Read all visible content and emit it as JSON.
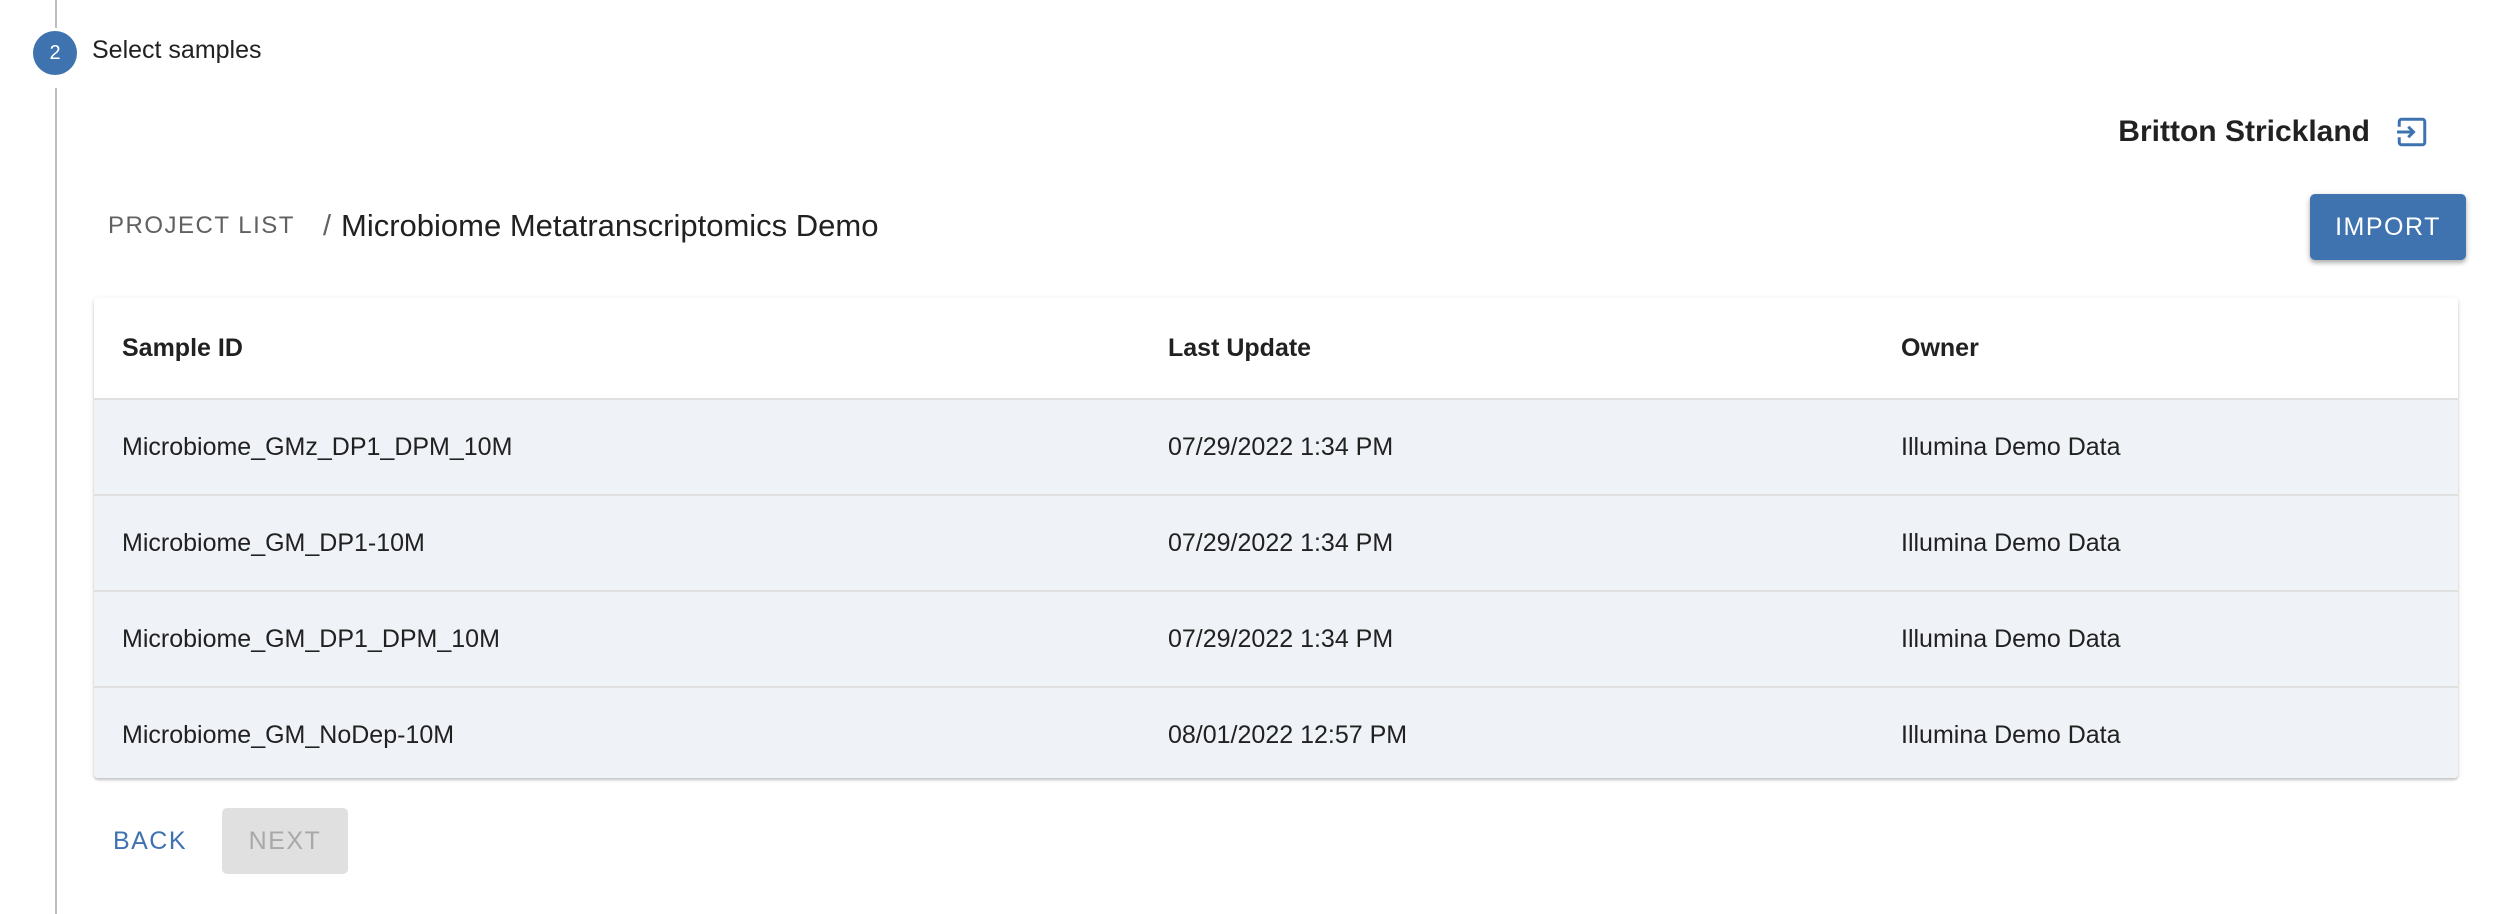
{
  "stepper": {
    "step_number": "2",
    "step_label": "Select samples"
  },
  "user": {
    "name": "Britton Strickland",
    "logout_icon": "logout-icon"
  },
  "breadcrumb": {
    "root_label": "PROJECT LIST",
    "separator": "/",
    "current": "Microbiome Metatranscriptomics Demo"
  },
  "actions": {
    "import_label": "IMPORT",
    "back_label": "BACK",
    "next_label": "NEXT",
    "next_disabled": true
  },
  "table": {
    "headers": [
      "Sample ID",
      "Last Update",
      "Owner"
    ],
    "rows": [
      {
        "sample_id": "Microbiome_GMz_DP1_DPM_10M",
        "last_update": "07/29/2022 1:34 PM",
        "owner": "Illumina Demo Data"
      },
      {
        "sample_id": "Microbiome_GM_DP1-10M",
        "last_update": "07/29/2022 1:34 PM",
        "owner": "Illumina Demo Data"
      },
      {
        "sample_id": "Microbiome_GM_DP1_DPM_10M",
        "last_update": "07/29/2022 1:34 PM",
        "owner": "Illumina Demo Data"
      },
      {
        "sample_id": "Microbiome_GM_NoDep-10M",
        "last_update": "08/01/2022 12:57 PM",
        "owner": "Illumina Demo Data"
      }
    ]
  },
  "colors": {
    "primary": "#3f73b0",
    "row_background": "#eff2f7",
    "disabled_background": "#e0e0e0",
    "disabled_text": "#a8a8a8"
  }
}
